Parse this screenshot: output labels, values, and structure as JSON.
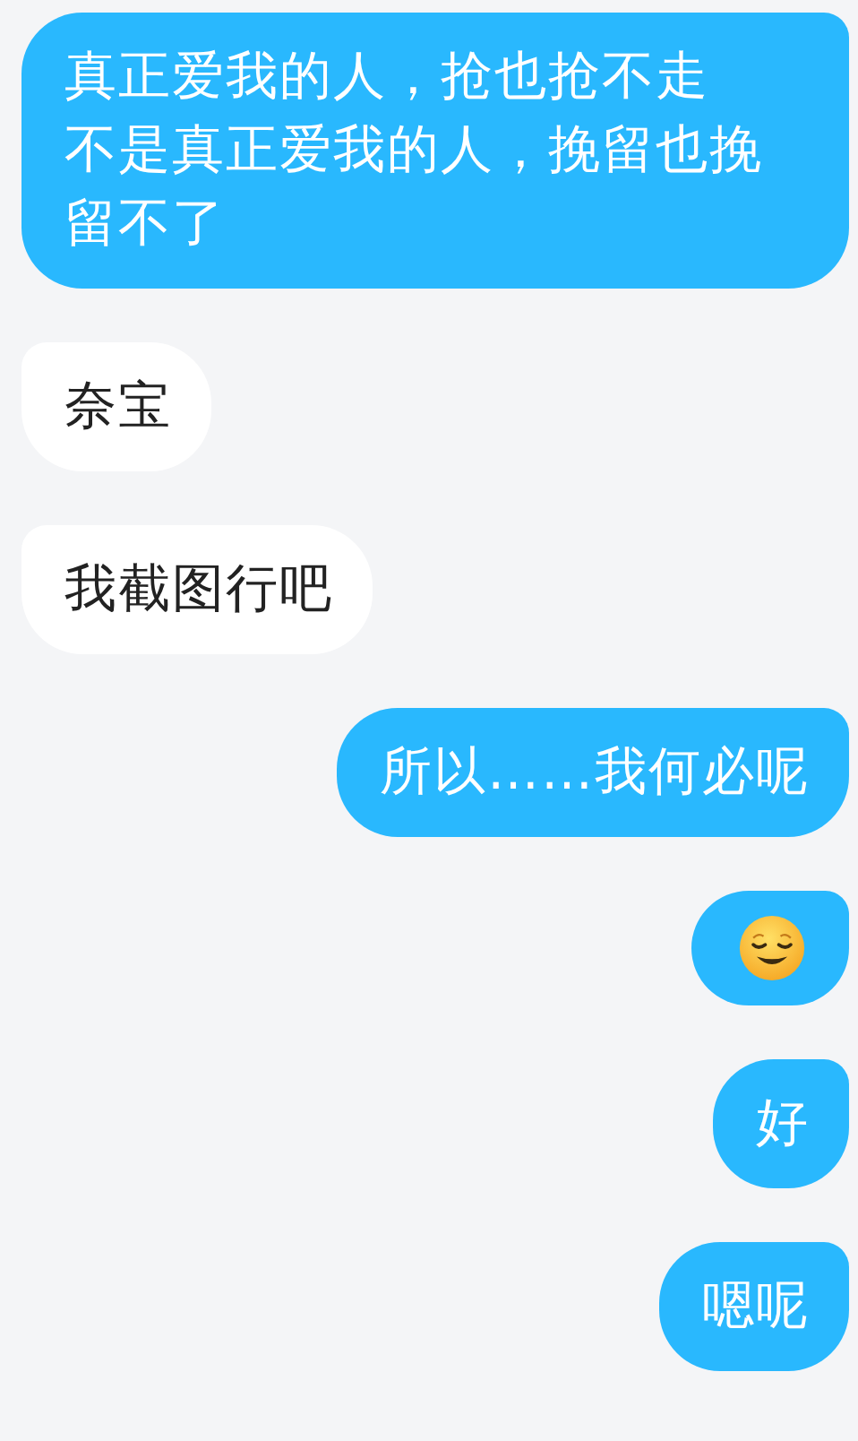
{
  "messages": [
    {
      "outgoing": true,
      "kind": "text",
      "lines": [
        "真正爱我的人，抢也抢不走",
        "不是真正爱我的人，挽留也挽留不了"
      ]
    },
    {
      "outgoing": false,
      "kind": "text",
      "text": "奈宝"
    },
    {
      "outgoing": false,
      "kind": "text",
      "text": "我截图行吧"
    },
    {
      "outgoing": true,
      "kind": "text",
      "text": "所以……我何必呢"
    },
    {
      "outgoing": true,
      "kind": "emoji"
    },
    {
      "outgoing": true,
      "kind": "text",
      "text": "好"
    },
    {
      "outgoing": true,
      "kind": "text",
      "text": "嗯呢"
    }
  ]
}
